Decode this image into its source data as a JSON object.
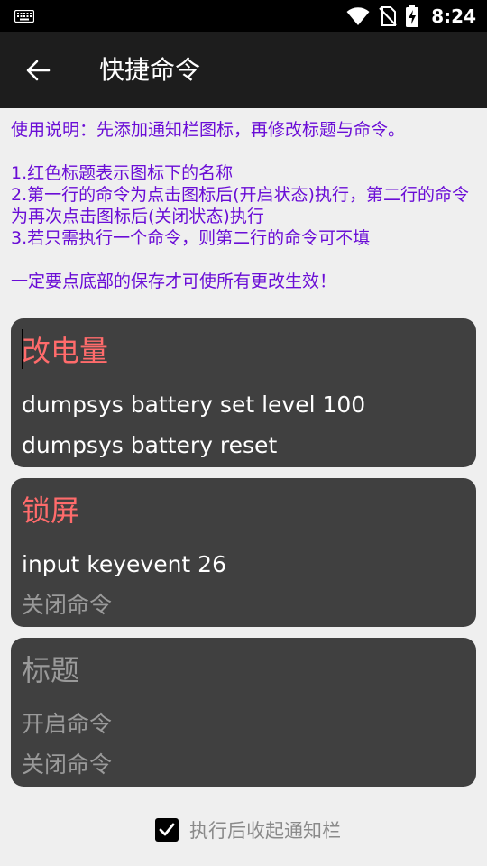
{
  "status_bar": {
    "time": "8:24",
    "icons": [
      "keyboard-icon",
      "wifi-icon",
      "no-sim-icon",
      "battery-charging-icon"
    ]
  },
  "app_bar": {
    "title": "快捷命令",
    "back_icon": "arrow-left-icon"
  },
  "instructions": {
    "line1": "使用说明：先添加通知栏图标，再修改标题与命令。",
    "item1": "1.红色标题表示图标下的名称",
    "item2": "2.第一行的命令为点击图标后(开启状态)执行，第二行的命令为再次点击图标后(关闭状态)执行",
    "item3": "3.若只需执行一个命令，则第二行的命令可不填",
    "warning": "一定要点底部的保存才可使所有更改生效！"
  },
  "cards": [
    {
      "title": "改电量",
      "on_command": "dumpsys battery set level 100",
      "off_command": "dumpsys battery reset"
    },
    {
      "title": "锁屏",
      "on_command": "input keyevent 26",
      "off_command_placeholder": "关闭命令"
    },
    {
      "title_placeholder": "标题",
      "on_command_placeholder": "开启命令",
      "off_command_placeholder": "关闭命令"
    }
  ],
  "collapse_option": {
    "label": "执行后收起通知栏",
    "checked": true
  },
  "colors": {
    "title_red": "#ff6b6b",
    "instruction_purple": "#6a0dd6",
    "card_bg": "#404040",
    "hint_gray": "#9a9a9a"
  }
}
